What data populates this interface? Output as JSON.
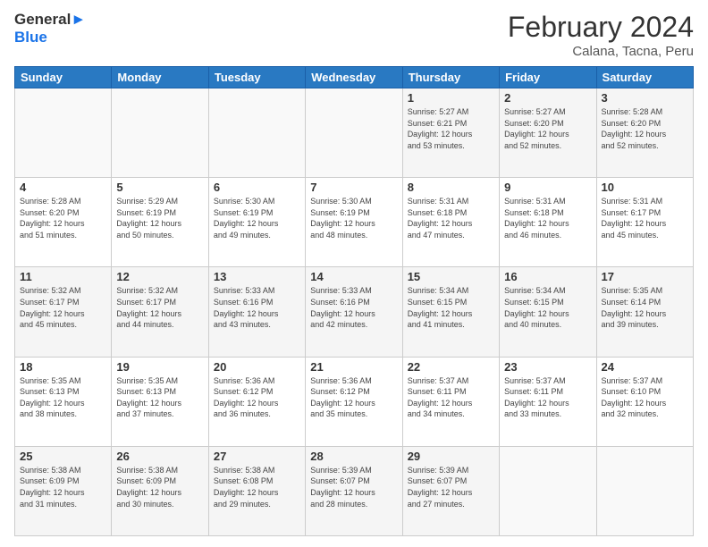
{
  "header": {
    "logo_line1": "General",
    "logo_line2": "Blue",
    "month": "February 2024",
    "location": "Calana, Tacna, Peru"
  },
  "weekdays": [
    "Sunday",
    "Monday",
    "Tuesday",
    "Wednesday",
    "Thursday",
    "Friday",
    "Saturday"
  ],
  "weeks": [
    [
      {
        "day": "",
        "info": ""
      },
      {
        "day": "",
        "info": ""
      },
      {
        "day": "",
        "info": ""
      },
      {
        "day": "",
        "info": ""
      },
      {
        "day": "1",
        "info": "Sunrise: 5:27 AM\nSunset: 6:21 PM\nDaylight: 12 hours\nand 53 minutes."
      },
      {
        "day": "2",
        "info": "Sunrise: 5:27 AM\nSunset: 6:20 PM\nDaylight: 12 hours\nand 52 minutes."
      },
      {
        "day": "3",
        "info": "Sunrise: 5:28 AM\nSunset: 6:20 PM\nDaylight: 12 hours\nand 52 minutes."
      }
    ],
    [
      {
        "day": "4",
        "info": "Sunrise: 5:28 AM\nSunset: 6:20 PM\nDaylight: 12 hours\nand 51 minutes."
      },
      {
        "day": "5",
        "info": "Sunrise: 5:29 AM\nSunset: 6:19 PM\nDaylight: 12 hours\nand 50 minutes."
      },
      {
        "day": "6",
        "info": "Sunrise: 5:30 AM\nSunset: 6:19 PM\nDaylight: 12 hours\nand 49 minutes."
      },
      {
        "day": "7",
        "info": "Sunrise: 5:30 AM\nSunset: 6:19 PM\nDaylight: 12 hours\nand 48 minutes."
      },
      {
        "day": "8",
        "info": "Sunrise: 5:31 AM\nSunset: 6:18 PM\nDaylight: 12 hours\nand 47 minutes."
      },
      {
        "day": "9",
        "info": "Sunrise: 5:31 AM\nSunset: 6:18 PM\nDaylight: 12 hours\nand 46 minutes."
      },
      {
        "day": "10",
        "info": "Sunrise: 5:31 AM\nSunset: 6:17 PM\nDaylight: 12 hours\nand 45 minutes."
      }
    ],
    [
      {
        "day": "11",
        "info": "Sunrise: 5:32 AM\nSunset: 6:17 PM\nDaylight: 12 hours\nand 45 minutes."
      },
      {
        "day": "12",
        "info": "Sunrise: 5:32 AM\nSunset: 6:17 PM\nDaylight: 12 hours\nand 44 minutes."
      },
      {
        "day": "13",
        "info": "Sunrise: 5:33 AM\nSunset: 6:16 PM\nDaylight: 12 hours\nand 43 minutes."
      },
      {
        "day": "14",
        "info": "Sunrise: 5:33 AM\nSunset: 6:16 PM\nDaylight: 12 hours\nand 42 minutes."
      },
      {
        "day": "15",
        "info": "Sunrise: 5:34 AM\nSunset: 6:15 PM\nDaylight: 12 hours\nand 41 minutes."
      },
      {
        "day": "16",
        "info": "Sunrise: 5:34 AM\nSunset: 6:15 PM\nDaylight: 12 hours\nand 40 minutes."
      },
      {
        "day": "17",
        "info": "Sunrise: 5:35 AM\nSunset: 6:14 PM\nDaylight: 12 hours\nand 39 minutes."
      }
    ],
    [
      {
        "day": "18",
        "info": "Sunrise: 5:35 AM\nSunset: 6:13 PM\nDaylight: 12 hours\nand 38 minutes."
      },
      {
        "day": "19",
        "info": "Sunrise: 5:35 AM\nSunset: 6:13 PM\nDaylight: 12 hours\nand 37 minutes."
      },
      {
        "day": "20",
        "info": "Sunrise: 5:36 AM\nSunset: 6:12 PM\nDaylight: 12 hours\nand 36 minutes."
      },
      {
        "day": "21",
        "info": "Sunrise: 5:36 AM\nSunset: 6:12 PM\nDaylight: 12 hours\nand 35 minutes."
      },
      {
        "day": "22",
        "info": "Sunrise: 5:37 AM\nSunset: 6:11 PM\nDaylight: 12 hours\nand 34 minutes."
      },
      {
        "day": "23",
        "info": "Sunrise: 5:37 AM\nSunset: 6:11 PM\nDaylight: 12 hours\nand 33 minutes."
      },
      {
        "day": "24",
        "info": "Sunrise: 5:37 AM\nSunset: 6:10 PM\nDaylight: 12 hours\nand 32 minutes."
      }
    ],
    [
      {
        "day": "25",
        "info": "Sunrise: 5:38 AM\nSunset: 6:09 PM\nDaylight: 12 hours\nand 31 minutes."
      },
      {
        "day": "26",
        "info": "Sunrise: 5:38 AM\nSunset: 6:09 PM\nDaylight: 12 hours\nand 30 minutes."
      },
      {
        "day": "27",
        "info": "Sunrise: 5:38 AM\nSunset: 6:08 PM\nDaylight: 12 hours\nand 29 minutes."
      },
      {
        "day": "28",
        "info": "Sunrise: 5:39 AM\nSunset: 6:07 PM\nDaylight: 12 hours\nand 28 minutes."
      },
      {
        "day": "29",
        "info": "Sunrise: 5:39 AM\nSunset: 6:07 PM\nDaylight: 12 hours\nand 27 minutes."
      },
      {
        "day": "",
        "info": ""
      },
      {
        "day": "",
        "info": ""
      }
    ]
  ]
}
